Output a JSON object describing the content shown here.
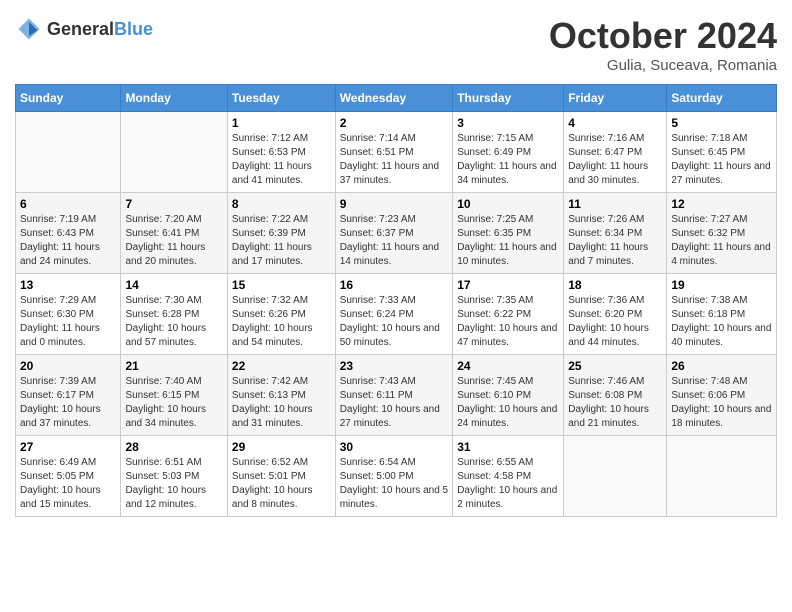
{
  "header": {
    "logo_general": "General",
    "logo_blue": "Blue",
    "month": "October 2024",
    "location": "Gulia, Suceava, Romania"
  },
  "weekdays": [
    "Sunday",
    "Monday",
    "Tuesday",
    "Wednesday",
    "Thursday",
    "Friday",
    "Saturday"
  ],
  "weeks": [
    [
      {
        "day": "",
        "sunrise": "",
        "sunset": "",
        "daylight": ""
      },
      {
        "day": "",
        "sunrise": "",
        "sunset": "",
        "daylight": ""
      },
      {
        "day": "1",
        "sunrise": "Sunrise: 7:12 AM",
        "sunset": "Sunset: 6:53 PM",
        "daylight": "Daylight: 11 hours and 41 minutes."
      },
      {
        "day": "2",
        "sunrise": "Sunrise: 7:14 AM",
        "sunset": "Sunset: 6:51 PM",
        "daylight": "Daylight: 11 hours and 37 minutes."
      },
      {
        "day": "3",
        "sunrise": "Sunrise: 7:15 AM",
        "sunset": "Sunset: 6:49 PM",
        "daylight": "Daylight: 11 hours and 34 minutes."
      },
      {
        "day": "4",
        "sunrise": "Sunrise: 7:16 AM",
        "sunset": "Sunset: 6:47 PM",
        "daylight": "Daylight: 11 hours and 30 minutes."
      },
      {
        "day": "5",
        "sunrise": "Sunrise: 7:18 AM",
        "sunset": "Sunset: 6:45 PM",
        "daylight": "Daylight: 11 hours and 27 minutes."
      }
    ],
    [
      {
        "day": "6",
        "sunrise": "Sunrise: 7:19 AM",
        "sunset": "Sunset: 6:43 PM",
        "daylight": "Daylight: 11 hours and 24 minutes."
      },
      {
        "day": "7",
        "sunrise": "Sunrise: 7:20 AM",
        "sunset": "Sunset: 6:41 PM",
        "daylight": "Daylight: 11 hours and 20 minutes."
      },
      {
        "day": "8",
        "sunrise": "Sunrise: 7:22 AM",
        "sunset": "Sunset: 6:39 PM",
        "daylight": "Daylight: 11 hours and 17 minutes."
      },
      {
        "day": "9",
        "sunrise": "Sunrise: 7:23 AM",
        "sunset": "Sunset: 6:37 PM",
        "daylight": "Daylight: 11 hours and 14 minutes."
      },
      {
        "day": "10",
        "sunrise": "Sunrise: 7:25 AM",
        "sunset": "Sunset: 6:35 PM",
        "daylight": "Daylight: 11 hours and 10 minutes."
      },
      {
        "day": "11",
        "sunrise": "Sunrise: 7:26 AM",
        "sunset": "Sunset: 6:34 PM",
        "daylight": "Daylight: 11 hours and 7 minutes."
      },
      {
        "day": "12",
        "sunrise": "Sunrise: 7:27 AM",
        "sunset": "Sunset: 6:32 PM",
        "daylight": "Daylight: 11 hours and 4 minutes."
      }
    ],
    [
      {
        "day": "13",
        "sunrise": "Sunrise: 7:29 AM",
        "sunset": "Sunset: 6:30 PM",
        "daylight": "Daylight: 11 hours and 0 minutes."
      },
      {
        "day": "14",
        "sunrise": "Sunrise: 7:30 AM",
        "sunset": "Sunset: 6:28 PM",
        "daylight": "Daylight: 10 hours and 57 minutes."
      },
      {
        "day": "15",
        "sunrise": "Sunrise: 7:32 AM",
        "sunset": "Sunset: 6:26 PM",
        "daylight": "Daylight: 10 hours and 54 minutes."
      },
      {
        "day": "16",
        "sunrise": "Sunrise: 7:33 AM",
        "sunset": "Sunset: 6:24 PM",
        "daylight": "Daylight: 10 hours and 50 minutes."
      },
      {
        "day": "17",
        "sunrise": "Sunrise: 7:35 AM",
        "sunset": "Sunset: 6:22 PM",
        "daylight": "Daylight: 10 hours and 47 minutes."
      },
      {
        "day": "18",
        "sunrise": "Sunrise: 7:36 AM",
        "sunset": "Sunset: 6:20 PM",
        "daylight": "Daylight: 10 hours and 44 minutes."
      },
      {
        "day": "19",
        "sunrise": "Sunrise: 7:38 AM",
        "sunset": "Sunset: 6:18 PM",
        "daylight": "Daylight: 10 hours and 40 minutes."
      }
    ],
    [
      {
        "day": "20",
        "sunrise": "Sunrise: 7:39 AM",
        "sunset": "Sunset: 6:17 PM",
        "daylight": "Daylight: 10 hours and 37 minutes."
      },
      {
        "day": "21",
        "sunrise": "Sunrise: 7:40 AM",
        "sunset": "Sunset: 6:15 PM",
        "daylight": "Daylight: 10 hours and 34 minutes."
      },
      {
        "day": "22",
        "sunrise": "Sunrise: 7:42 AM",
        "sunset": "Sunset: 6:13 PM",
        "daylight": "Daylight: 10 hours and 31 minutes."
      },
      {
        "day": "23",
        "sunrise": "Sunrise: 7:43 AM",
        "sunset": "Sunset: 6:11 PM",
        "daylight": "Daylight: 10 hours and 27 minutes."
      },
      {
        "day": "24",
        "sunrise": "Sunrise: 7:45 AM",
        "sunset": "Sunset: 6:10 PM",
        "daylight": "Daylight: 10 hours and 24 minutes."
      },
      {
        "day": "25",
        "sunrise": "Sunrise: 7:46 AM",
        "sunset": "Sunset: 6:08 PM",
        "daylight": "Daylight: 10 hours and 21 minutes."
      },
      {
        "day": "26",
        "sunrise": "Sunrise: 7:48 AM",
        "sunset": "Sunset: 6:06 PM",
        "daylight": "Daylight: 10 hours and 18 minutes."
      }
    ],
    [
      {
        "day": "27",
        "sunrise": "Sunrise: 6:49 AM",
        "sunset": "Sunset: 5:05 PM",
        "daylight": "Daylight: 10 hours and 15 minutes."
      },
      {
        "day": "28",
        "sunrise": "Sunrise: 6:51 AM",
        "sunset": "Sunset: 5:03 PM",
        "daylight": "Daylight: 10 hours and 12 minutes."
      },
      {
        "day": "29",
        "sunrise": "Sunrise: 6:52 AM",
        "sunset": "Sunset: 5:01 PM",
        "daylight": "Daylight: 10 hours and 8 minutes."
      },
      {
        "day": "30",
        "sunrise": "Sunrise: 6:54 AM",
        "sunset": "Sunset: 5:00 PM",
        "daylight": "Daylight: 10 hours and 5 minutes."
      },
      {
        "day": "31",
        "sunrise": "Sunrise: 6:55 AM",
        "sunset": "Sunset: 4:58 PM",
        "daylight": "Daylight: 10 hours and 2 minutes."
      },
      {
        "day": "",
        "sunrise": "",
        "sunset": "",
        "daylight": ""
      },
      {
        "day": "",
        "sunrise": "",
        "sunset": "",
        "daylight": ""
      }
    ]
  ]
}
